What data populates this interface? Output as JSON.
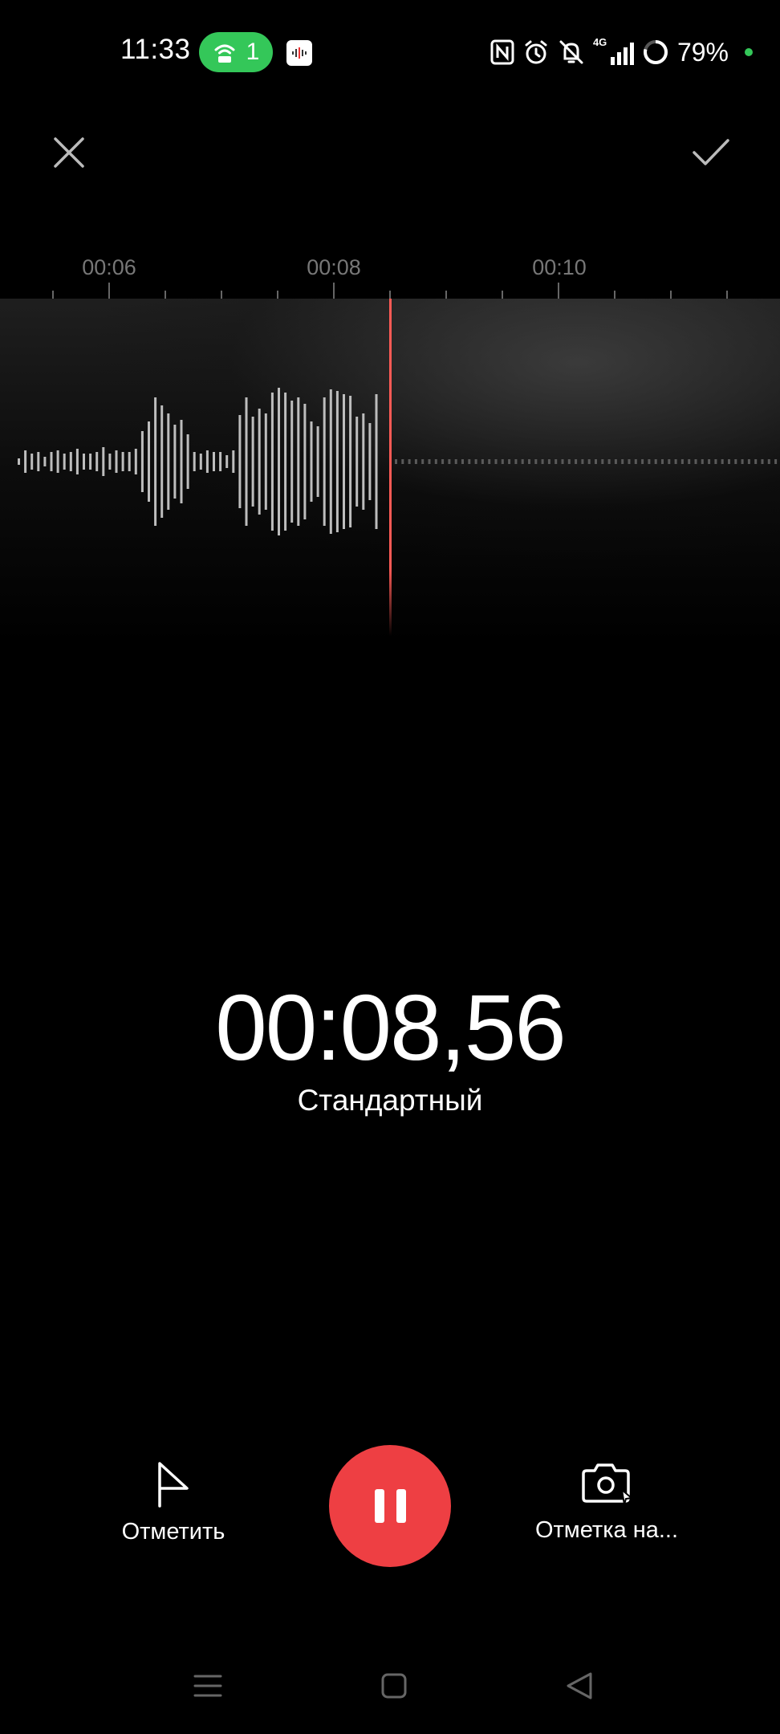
{
  "status_bar": {
    "time": "11:33",
    "hotspot_count": "1",
    "network": "4G",
    "battery": "79%",
    "colors": {
      "hotspot": "#34c759",
      "dot": "#34c759"
    }
  },
  "timeline": {
    "ticks": [
      "00:06",
      "00:08",
      "00:10"
    ]
  },
  "recording": {
    "elapsed": "00:08,56",
    "mode": "Стандартный"
  },
  "controls": {
    "mark_label": "Отметить",
    "photo_label": "Отметка на...",
    "accent": "#ee3f43"
  },
  "icons": {
    "close": "close-icon",
    "done": "check-icon",
    "mark": "flag-icon",
    "photo": "camera-icon",
    "pause": "pause-icon"
  }
}
